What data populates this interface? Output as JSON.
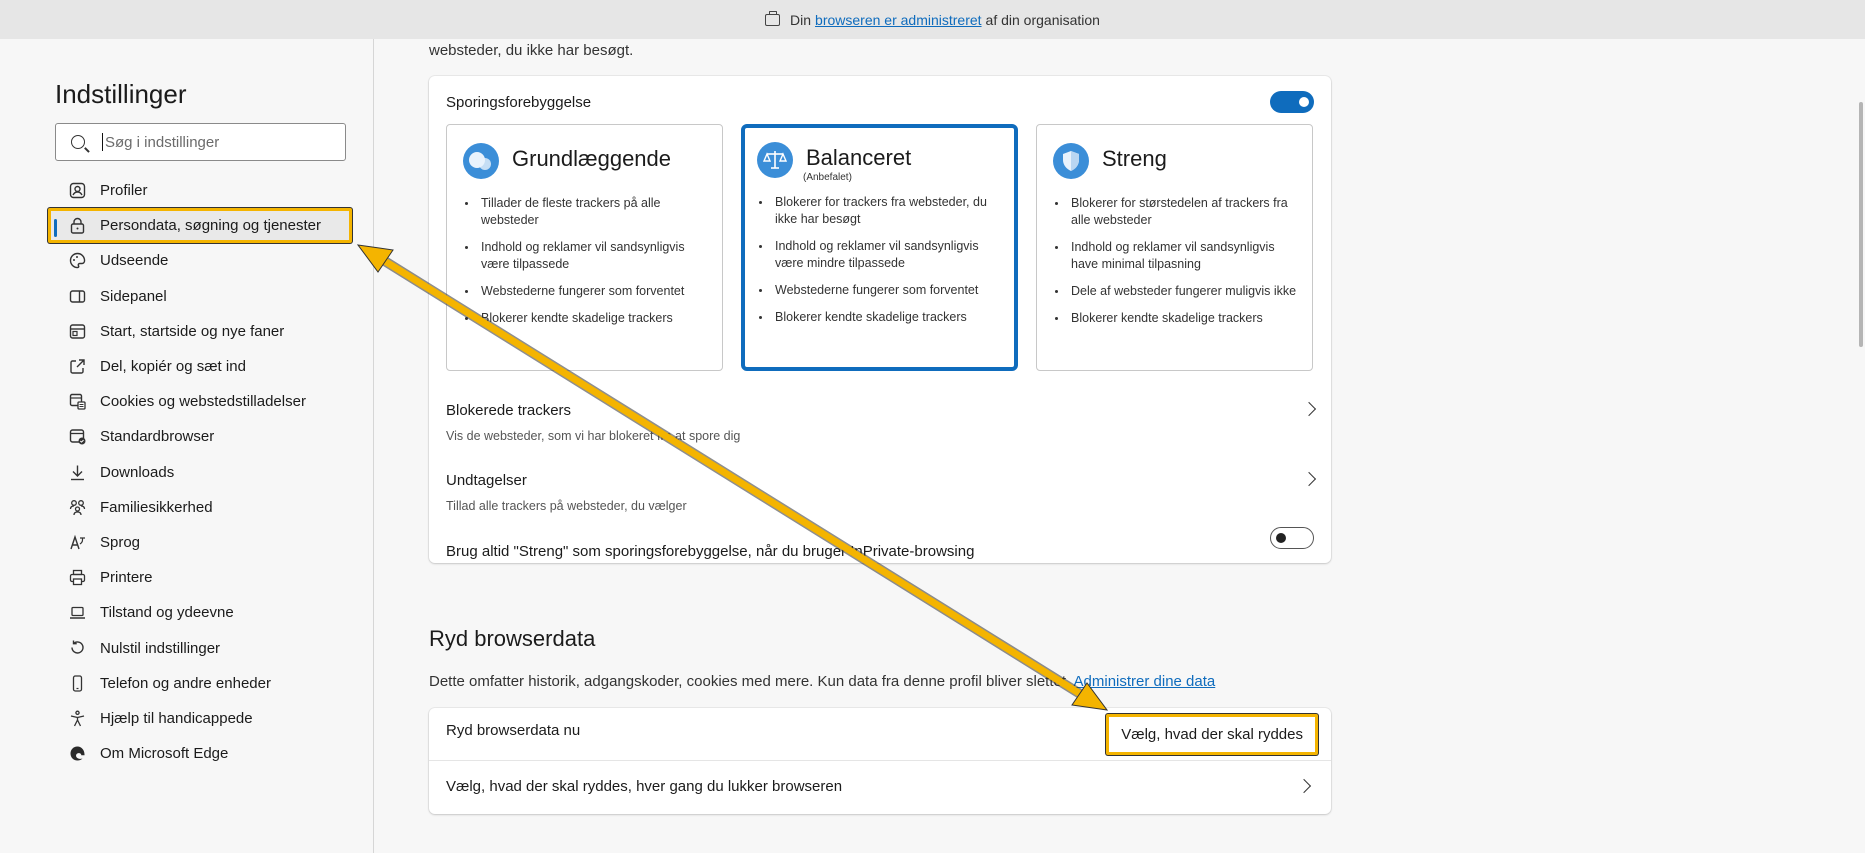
{
  "banner": {
    "pre": "Din",
    "link": "browseren er administreret",
    "post": "af din organisation"
  },
  "sidebar": {
    "title": "Indstillinger",
    "search_placeholder": "Søg i indstillinger",
    "items": [
      {
        "label": "Profiler",
        "icon": "profile-icon"
      },
      {
        "label": "Persondata, søgning og tjenester",
        "icon": "lock-icon",
        "active": true
      },
      {
        "label": "Udseende",
        "icon": "appearance-icon"
      },
      {
        "label": "Sidepanel",
        "icon": "sidebar-panel-icon"
      },
      {
        "label": "Start, startside og nye faner",
        "icon": "home-tab-icon"
      },
      {
        "label": "Del, kopiér og sæt ind",
        "icon": "share-icon"
      },
      {
        "label": "Cookies og webstedstilladelser",
        "icon": "cookies-icon"
      },
      {
        "label": "Standardbrowser",
        "icon": "default-browser-icon"
      },
      {
        "label": "Downloads",
        "icon": "download-icon"
      },
      {
        "label": "Familiesikkerhed",
        "icon": "family-icon"
      },
      {
        "label": "Sprog",
        "icon": "language-icon"
      },
      {
        "label": "Printere",
        "icon": "printer-icon"
      },
      {
        "label": "Tilstand og ydeevne",
        "icon": "laptop-icon"
      },
      {
        "label": "Nulstil indstillinger",
        "icon": "reset-icon"
      },
      {
        "label": "Telefon og andre enheder",
        "icon": "phone-icon"
      },
      {
        "label": "Hjælp til handicappede",
        "icon": "accessibility-icon"
      },
      {
        "label": "Om Microsoft Edge",
        "icon": "edge-icon"
      }
    ]
  },
  "main": {
    "top_snippet": "websteder, du ikke har besøgt.",
    "tracking": {
      "title": "Sporingsforebyggelse",
      "enabled": true,
      "options": [
        {
          "name": "Grundlæggende",
          "sub": "",
          "selected": false,
          "icon": "basic-icon",
          "bullets": [
            "Tillader de fleste trackers på alle websteder",
            "Indhold og reklamer vil sandsynligvis være tilpassede",
            "Webstederne fungerer som forventet",
            "Blokerer kendte skadelige trackers"
          ]
        },
        {
          "name": "Balanceret",
          "sub": "(Anbefalet)",
          "selected": true,
          "icon": "scale-icon",
          "bullets": [
            "Blokerer for trackers fra websteder, du ikke har besøgt",
            "Indhold og reklamer vil sandsynligvis være mindre tilpassede",
            "Webstederne fungerer som forventet",
            "Blokerer kendte skadelige trackers"
          ]
        },
        {
          "name": "Streng",
          "sub": "",
          "selected": false,
          "icon": "shield-icon",
          "bullets": [
            "Blokerer for størstedelen af trackers fra alle websteder",
            "Indhold og reklamer vil sandsynligvis have minimal tilpasning",
            "Dele af websteder fungerer muligvis ikke",
            "Blokerer kendte skadelige trackers"
          ]
        }
      ],
      "blocked_title": "Blokerede trackers",
      "blocked_sub": "Vis de websteder, som vi har blokeret fra at spore dig",
      "exceptions_title": "Undtagelser",
      "exceptions_sub": "Tillad alle trackers på websteder, du vælger",
      "inprivate_label": "Brug altid \"Streng\" som sporingsforebyggelse, når du bruger InPrivate-browsing",
      "inprivate_enabled": false
    },
    "clear": {
      "title": "Ryd browserdata",
      "desc": "Dette omfatter historik, adgangskoder, cookies med mere. Kun data fra denne profil bliver slettet.",
      "desc_link": "Administrer dine data",
      "now_label": "Ryd browserdata nu",
      "choose_button": "Vælg, hvad der skal ryddes",
      "on_close_label": "Vælg, hvad der skal ryddes, hver gang du lukker browseren"
    }
  },
  "colors": {
    "accent": "#0f6cbd",
    "highlight": "#f4b400",
    "arrow": "#f4b400"
  }
}
